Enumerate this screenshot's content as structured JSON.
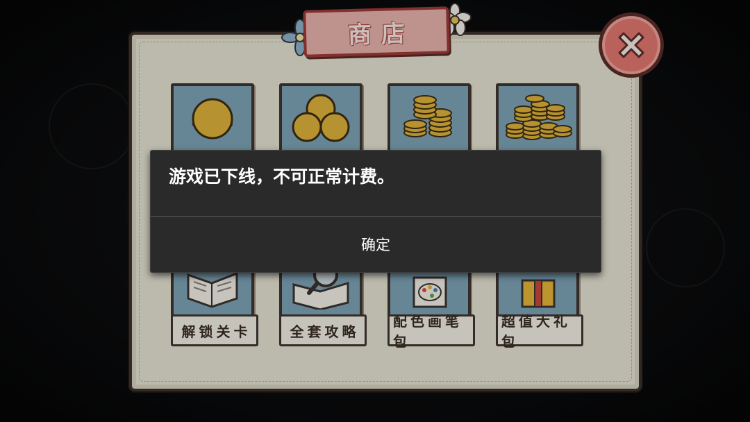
{
  "shop": {
    "title": "商店",
    "close_icon": "close-x-icon",
    "coin_packs": [
      {
        "icon": "coin-single-icon"
      },
      {
        "icon": "coin-triple-icon"
      },
      {
        "icon": "coin-stack-icon"
      },
      {
        "icon": "coin-pile-icon"
      }
    ],
    "items": [
      {
        "label": "解锁关卡",
        "icon": "open-book-icon"
      },
      {
        "label": "全套攻略",
        "icon": "magnifier-book-icon"
      },
      {
        "label": "配色画笔包",
        "icon": "palette-icon"
      },
      {
        "label": "超值大礼包",
        "icon": "gift-box-icon"
      }
    ]
  },
  "dialog": {
    "message": "游戏已下线，不可正常计费。",
    "confirm_label": "确定"
  },
  "colors": {
    "panel_bg": "#e6e3d3",
    "banner_bg": "#e8b4ac",
    "close_bg": "#e1786f",
    "card_bg": "#7ea4b6",
    "coin": "#e0b33c",
    "dialog_bg": "#2a2a2a"
  }
}
